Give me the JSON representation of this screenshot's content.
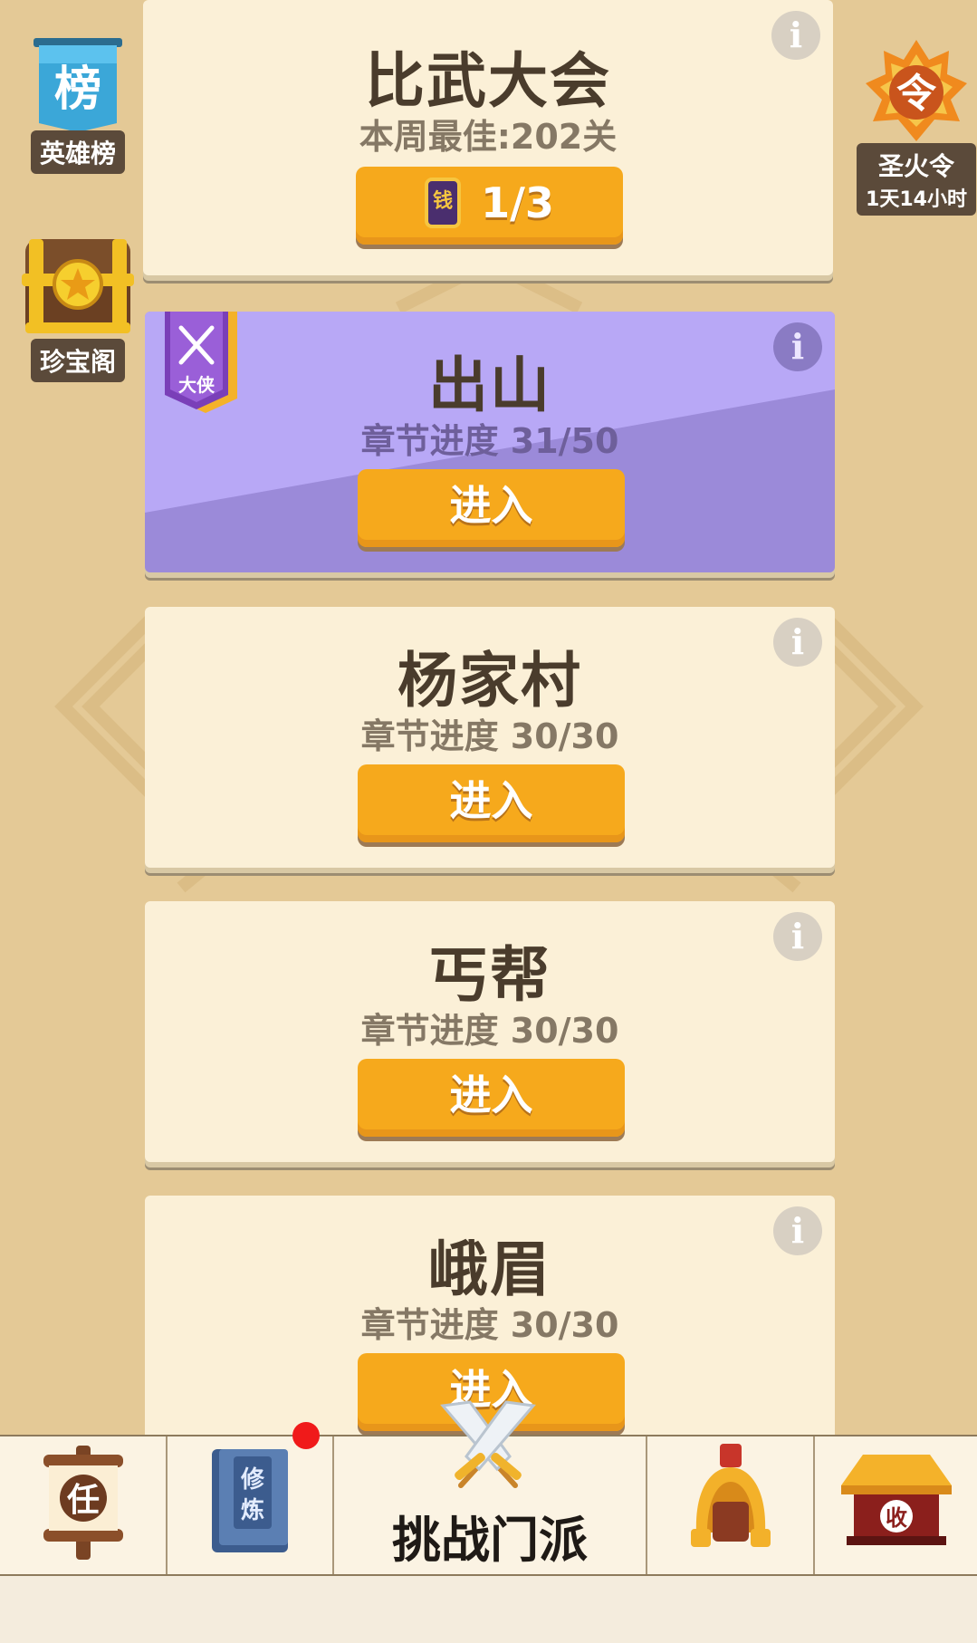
{
  "side_left": {
    "ranking_icon_text": "榜",
    "ranking_label": "英雄榜",
    "treasure_label": "珍宝阁"
  },
  "side_right": {
    "token_icon_text": "令",
    "token_label": "圣火令",
    "token_timer": "1天14小时"
  },
  "cards": [
    {
      "title": "比武大会",
      "subtitle": "本周最佳:202关",
      "ticket_icon_text": "钱",
      "button_label": "1/3"
    },
    {
      "title": "出山",
      "subtitle": "章节进度 31/50",
      "badge_text": "大侠",
      "button_label": "进入"
    },
    {
      "title": "杨家村",
      "subtitle": "章节进度 30/30",
      "button_label": "进入"
    },
    {
      "title": "丐帮",
      "subtitle": "章节进度 30/30",
      "button_label": "进入"
    },
    {
      "title": "峨眉",
      "subtitle": "章节进度 30/30",
      "button_label": "进入"
    }
  ],
  "info_glyph": "i",
  "bottom_nav": {
    "task_icon_text": "任",
    "cultivate_icon_text": "修炼",
    "challenge_label": "挑战门派",
    "shop_icon_text": "收"
  },
  "colors": {
    "background": "#e4c996",
    "card": "#fbf0d7",
    "card_highlight": "#9b8ad9",
    "button": "#f6a91c",
    "notification": "#f01a1a"
  }
}
